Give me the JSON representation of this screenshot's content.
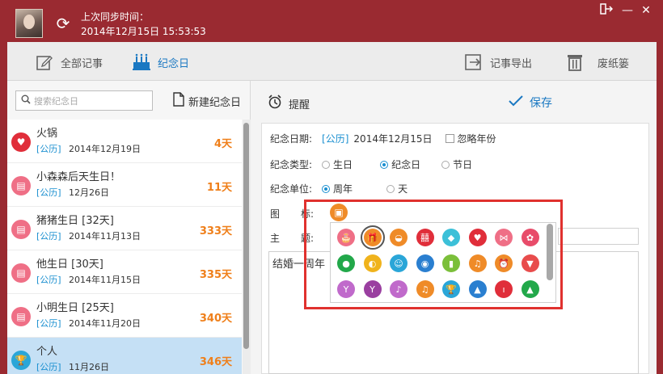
{
  "titlebar": {
    "sync_label": "上次同步时间：",
    "sync_time": "2014年12月15日 15:53:53"
  },
  "toolbar": {
    "all_notes": "全部记事",
    "anniversary": "纪念日",
    "export": "记事导出",
    "trash": "废纸篓"
  },
  "left": {
    "search_placeholder": "搜索纪念日",
    "new_label": "新建纪念日",
    "items": [
      {
        "name": "火锅",
        "cal": "[公历]",
        "date": "2014年12月19日",
        "days": "4天",
        "color": "#e02e3a",
        "icon": "heart"
      },
      {
        "name": "小森森后天生日！",
        "cal": "[公历]",
        "date": "12月26日",
        "days": "11天",
        "color": "#ef6f86",
        "icon": "cake"
      },
      {
        "name": "猪猪生日  [32天]",
        "cal": "[公历]",
        "date": "2014年11月13日",
        "days": "333天",
        "color": "#ef6f86",
        "icon": "cake"
      },
      {
        "name": "他生日  [30天]",
        "cal": "[公历]",
        "date": "2014年11月15日",
        "days": "335天",
        "color": "#ef6f86",
        "icon": "cake"
      },
      {
        "name": "小明生日  [25天]",
        "cal": "[公历]",
        "date": "2014年11月20日",
        "days": "340天",
        "color": "#ef6f86",
        "icon": "cake"
      },
      {
        "name": "个人",
        "cal": "[公历]",
        "date": "11月26日",
        "days": "346天",
        "color": "#2aa6d8",
        "icon": "trophy"
      }
    ]
  },
  "right": {
    "remind": "提醒",
    "save": "保存",
    "date_label": "纪念日期:",
    "date_cal": "[公历]",
    "date_value": "2014年12月15日",
    "ignore_year": "忽略年份",
    "type_label": "纪念类型:",
    "type_options": [
      "生日",
      "纪念日",
      "节日"
    ],
    "unit_label": "纪念单位:",
    "unit_options": [
      "周年",
      "天"
    ],
    "icon_label_a": "图",
    "icon_label_b": "标:",
    "subject_label_a": "主",
    "subject_label_b": "题:",
    "content": "结婚一周年"
  },
  "icons": [
    {
      "name": "cake-icon",
      "color": "#ef6f86",
      "glyph": "🎂"
    },
    {
      "name": "gift-icon",
      "color": "#ef8b28",
      "glyph": "🎁"
    },
    {
      "name": "cupcake-icon",
      "color": "#ef8b28",
      "glyph": "◒"
    },
    {
      "name": "double-happiness-icon",
      "color": "#e02e3a",
      "glyph": "囍"
    },
    {
      "name": "diamond-icon",
      "color": "#3cc0d8",
      "glyph": "◆"
    },
    {
      "name": "heart-icon",
      "color": "#e02e3a",
      "glyph": "♥"
    },
    {
      "name": "bow-icon",
      "color": "#ef6f86",
      "glyph": "⋈"
    },
    {
      "name": "rose-icon",
      "color": "#e84c6a",
      "glyph": "✿"
    },
    {
      "name": "balloon-icon",
      "color": "#22a84a",
      "glyph": "●"
    },
    {
      "name": "stroller-icon",
      "color": "#f0b31c",
      "glyph": "◐"
    },
    {
      "name": "baby-icon",
      "color": "#2aa6d8",
      "glyph": "☺"
    },
    {
      "name": "pacifier-icon",
      "color": "#2a7fd0",
      "glyph": "◉"
    },
    {
      "name": "bottle-icon",
      "color": "#7bbf3a",
      "glyph": "▮"
    },
    {
      "name": "bell-icon",
      "color": "#ef8b28",
      "glyph": "♫"
    },
    {
      "name": "alarm-clock-icon",
      "color": "#ef8b28",
      "glyph": "⏰"
    },
    {
      "name": "ice-cream-icon",
      "color": "#e84c4c",
      "glyph": "▼"
    },
    {
      "name": "cheers-icon",
      "color": "#c06acb",
      "glyph": "Y"
    },
    {
      "name": "wine-glass-icon",
      "color": "#9a3fa0",
      "glyph": "Y"
    },
    {
      "name": "music-note-icon",
      "color": "#c06acb",
      "glyph": "♪"
    },
    {
      "name": "music-notes-icon",
      "color": "#ef8b28",
      "glyph": "♫"
    },
    {
      "name": "trophy-icon",
      "color": "#2aa6d8",
      "glyph": "🏆"
    },
    {
      "name": "graduation-cap-icon",
      "color": "#2a7fd0",
      "glyph": "▲"
    },
    {
      "name": "candle-icon",
      "color": "#e02e3a",
      "glyph": "ı"
    },
    {
      "name": "christmas-tree-icon",
      "color": "#22a84a",
      "glyph": "▲"
    }
  ]
}
